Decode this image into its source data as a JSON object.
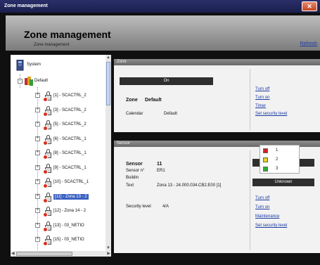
{
  "window": {
    "title": "Zone management",
    "close_glyph": "✕"
  },
  "header": {
    "title": "Zone management",
    "subtitle": "Zone management",
    "refresh_link": "Refresh"
  },
  "tree": {
    "root": "System",
    "group": "Default",
    "items": [
      {
        "label": "[1] - SCACTRL_2"
      },
      {
        "label": "[3] - SCACTRL_2"
      },
      {
        "label": "[5] - SCACTRL_2"
      },
      {
        "label": "[6] - SCACTRL_1"
      },
      {
        "label": "[8] - SCACTRL_1"
      },
      {
        "label": "[9] - SCACTRL_1"
      },
      {
        "label": "[10] - SCACTRL_1"
      },
      {
        "label": "[11] - Zona 13 - 2"
      },
      {
        "label": "[12] - Zona 14 - 2"
      },
      {
        "label": "[13] - 03_NETIO"
      },
      {
        "label": "[15] - 03_NETIO"
      }
    ],
    "selected_index": 7,
    "expander_minus": "−",
    "expander_plus": "+",
    "scroll_up": "▲",
    "scroll_down": "▼",
    "scroll_left": "◀",
    "scroll_right": "▶"
  },
  "zone_panel": {
    "title": "Zone",
    "state": "On",
    "zone_label": "Zone",
    "zone_value": "Default",
    "calendar_label": "Calendar",
    "calendar_value": "Default",
    "actions": [
      "Turn off",
      "Turn on",
      "Timer",
      "Set security level"
    ]
  },
  "sensor_panel": {
    "title": "Sensor",
    "sensor_label": "Sensor",
    "sensor_value": "11",
    "sensor_no_label": "Sensor n°",
    "sensor_no_value": "ER1",
    "building_label": "Buildin",
    "text_label": "Text",
    "text_value": "Zona 13 - 24.000.034.CB2.E00 [1]",
    "security_level_label": "Security level",
    "security_level_value": "4/A",
    "status": "Unknown",
    "actions": [
      "Turn off",
      "Turn on",
      "Maintenance",
      "Set security level"
    ]
  },
  "legend": {
    "items": [
      {
        "label": "1",
        "color": "#d42020"
      },
      {
        "label": "2",
        "color": "#e8d020"
      },
      {
        "label": "3",
        "color": "#30b030"
      }
    ]
  },
  "colors": {
    "selection": "#3c62c2",
    "link": "#1a3aa3",
    "lock_dot": "#d83020"
  }
}
